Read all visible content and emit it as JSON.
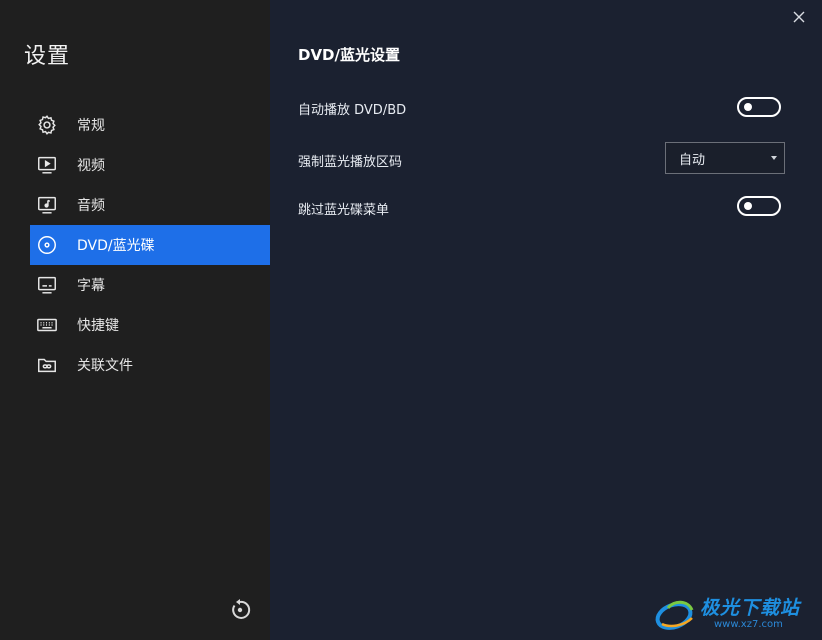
{
  "sidebar": {
    "title": "设置",
    "items": [
      {
        "label": "常规",
        "icon": "gear-icon"
      },
      {
        "label": "视频",
        "icon": "video-icon"
      },
      {
        "label": "音频",
        "icon": "audio-icon"
      },
      {
        "label": "DVD/蓝光碟",
        "icon": "disc-icon",
        "active": true
      },
      {
        "label": "字幕",
        "icon": "subtitle-icon"
      },
      {
        "label": "快捷键",
        "icon": "keyboard-icon"
      },
      {
        "label": "关联文件",
        "icon": "folder-link-icon"
      }
    ],
    "reset_icon": "reset-icon"
  },
  "main": {
    "section_title": "DVD/蓝光设置",
    "settings": [
      {
        "label": "自动播放 DVD/BD",
        "control": "toggle",
        "value": false
      },
      {
        "label": "强制蓝光播放区码",
        "control": "select",
        "value": "自动"
      },
      {
        "label": "跳过蓝光碟菜单",
        "control": "toggle",
        "value": false
      }
    ]
  },
  "watermark": {
    "main": "极光下载站",
    "sub": "www.xz7.com"
  },
  "colors": {
    "sidebar_bg": "#1f1f1f",
    "main_bg": "#1b2130",
    "accent": "#1e6fe8"
  }
}
